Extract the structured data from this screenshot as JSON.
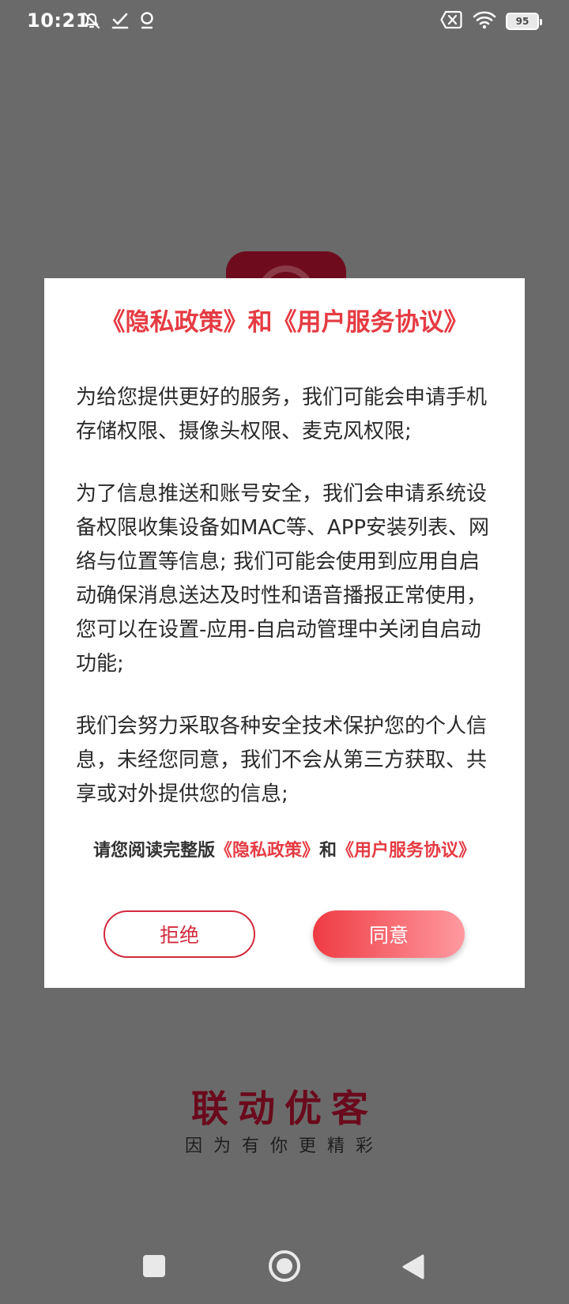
{
  "status_bar": {
    "time": "10:21",
    "battery_level": "95",
    "icons": [
      "notification-mute-icon",
      "check-icon",
      "location-pin-icon",
      "sim-x-icon",
      "wifi-icon",
      "battery-icon"
    ]
  },
  "dialog": {
    "title": "《隐私政策》和《用户服务协议》",
    "paragraphs": [
      "为给您提供更好的服务，我们可能会申请手机存储权限、摄像头权限、麦克风权限;",
      "为了信息推送和账号安全，我们会申请系统设备权限收集设备如MAC等、APP安装列表、网络与位置等信息; 我们可能会使用到应用自启动确保消息送达及时性和语音播报正常使用，您可以在设置-应用-自启动管理中关闭自启动功能;",
      "我们会努力采取各种安全技术保护您的个人信息，未经您同意，我们不会从第三方获取、共享或对外提供您的信息;"
    ],
    "read_prefix": "请您阅读完整版",
    "privacy_link": "《隐私政策》",
    "read_and": "和",
    "service_link": "《用户服务协议》",
    "reject_label": "拒绝",
    "agree_label": "同意"
  },
  "brand": {
    "name": "联动优客",
    "slogan": "因为有你更精彩"
  },
  "colors": {
    "accent": "#e53b43",
    "reject_border": "#d22b3d",
    "brand": "#6a0a1c",
    "overlay": "#6a6a6a"
  }
}
